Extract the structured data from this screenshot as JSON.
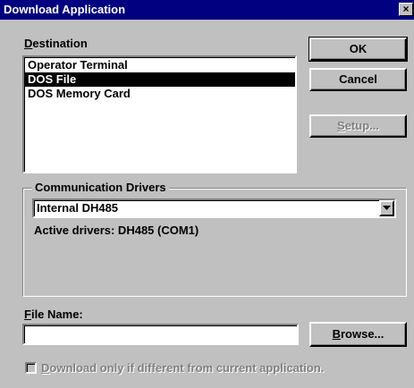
{
  "window": {
    "title": "Download Application",
    "close_glyph": "×"
  },
  "destination": {
    "label_prefix": "",
    "label_accel": "D",
    "label_rest": "estination",
    "items": [
      {
        "label": "Operator Terminal",
        "selected": false
      },
      {
        "label": "DOS File",
        "selected": true
      },
      {
        "label": "DOS Memory Card",
        "selected": false
      }
    ]
  },
  "buttons": {
    "ok": "OK",
    "cancel": "Cancel",
    "setup_accel": "S",
    "setup_rest": "etup...",
    "browse_accel": "B",
    "browse_rest": "rowse..."
  },
  "comm_drivers": {
    "title": "Communication Drivers",
    "selected_value": "Internal DH485",
    "active_text": "Active drivers: DH485 (COM1)"
  },
  "file_name": {
    "label_accel": "F",
    "label_rest": "ile Name:",
    "value": ""
  },
  "checkbox": {
    "label_accel": "D",
    "label_rest": "ownload only if different from current application.",
    "checked": false,
    "enabled": false
  },
  "icons": {
    "close": "close-icon",
    "dropdown": "chevron-down-icon"
  },
  "colors": {
    "titlebar": "#000080",
    "face": "#c0c0c0",
    "selection": "#000000",
    "disabled_text": "#808080"
  }
}
